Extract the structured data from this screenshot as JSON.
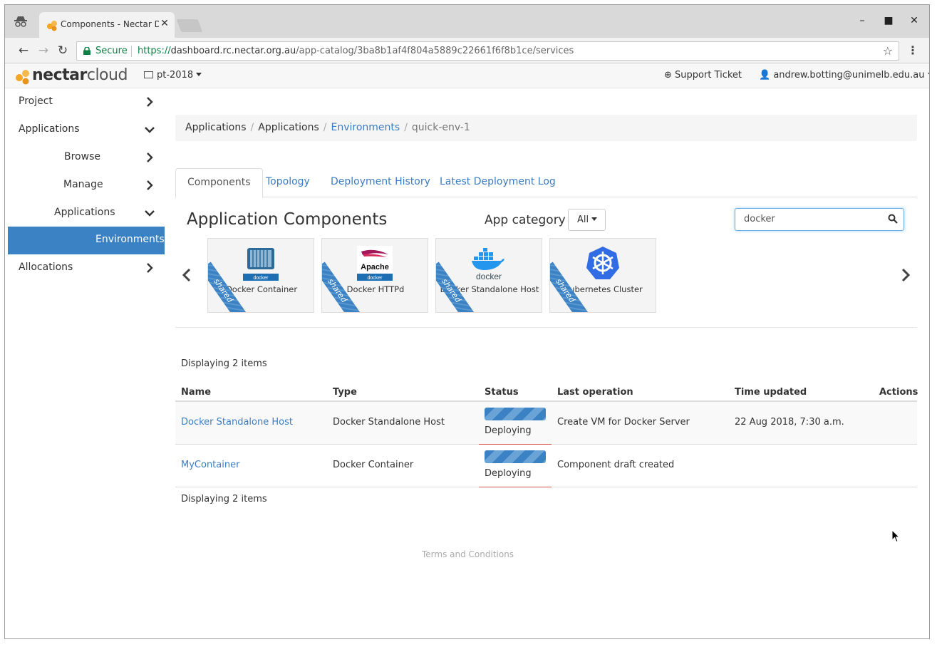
{
  "browser": {
    "tab_title": "Components - Nectar Dashl",
    "secure_label": "Secure",
    "url_protocol": "https://",
    "url_host": "dashboard.rc.nectar.org.au",
    "url_path": "/app-catalog/3ba8b1af4f804a5889c22661f6f8b1ce/services"
  },
  "header": {
    "logo_word1": "nectar",
    "logo_word2": "cloud",
    "project": "pt-2018",
    "support": "Support Ticket",
    "user": "andrew.botting@unimelb.edu.au"
  },
  "sidebar": {
    "items": [
      {
        "label": "Project"
      },
      {
        "label": "Applications"
      },
      {
        "label": "Browse"
      },
      {
        "label": "Manage"
      },
      {
        "label": "Applications"
      },
      {
        "label": "Environments"
      },
      {
        "label": "Allocations"
      }
    ]
  },
  "breadcrumb": [
    "Applications",
    "Applications",
    "Environments",
    "quick-env-1"
  ],
  "tabs": [
    "Components",
    "Topology",
    "Deployment History",
    "Latest Deployment Log"
  ],
  "components": {
    "title": "Application Components",
    "category_label": "App category",
    "category_value": "All",
    "search_value": "docker",
    "cards": [
      {
        "name": "Docker Container",
        "ribbon": "shared"
      },
      {
        "name": "Docker HTTPd",
        "ribbon": "shared",
        "logo_text": "Apache"
      },
      {
        "name": "Docker Standalone Host",
        "ribbon": "shared",
        "logo_text": "docker"
      },
      {
        "name": "Kubernetes Cluster",
        "ribbon": "shared"
      }
    ],
    "small_logo_text": "docker"
  },
  "table": {
    "display_count": "Displaying 2 items",
    "columns": [
      "Name",
      "Type",
      "Status",
      "Last operation",
      "Time updated",
      "Actions"
    ],
    "rows": [
      {
        "name": "Docker Standalone Host",
        "type": "Docker Standalone Host",
        "status": "Deploying",
        "last_operation": "Create VM for Docker Server",
        "time_updated": "22 Aug 2018, 7:30 a.m."
      },
      {
        "name": "MyContainer",
        "type": "Docker Container",
        "status": "Deploying",
        "last_operation": "Component draft created",
        "time_updated": ""
      }
    ]
  },
  "footer": {
    "terms": "Terms and Conditions"
  },
  "colors": {
    "accent": "#3b82c4",
    "link": "#3b7dc4",
    "brand_orange": "#f5a623",
    "secure_green": "#0b8043"
  }
}
